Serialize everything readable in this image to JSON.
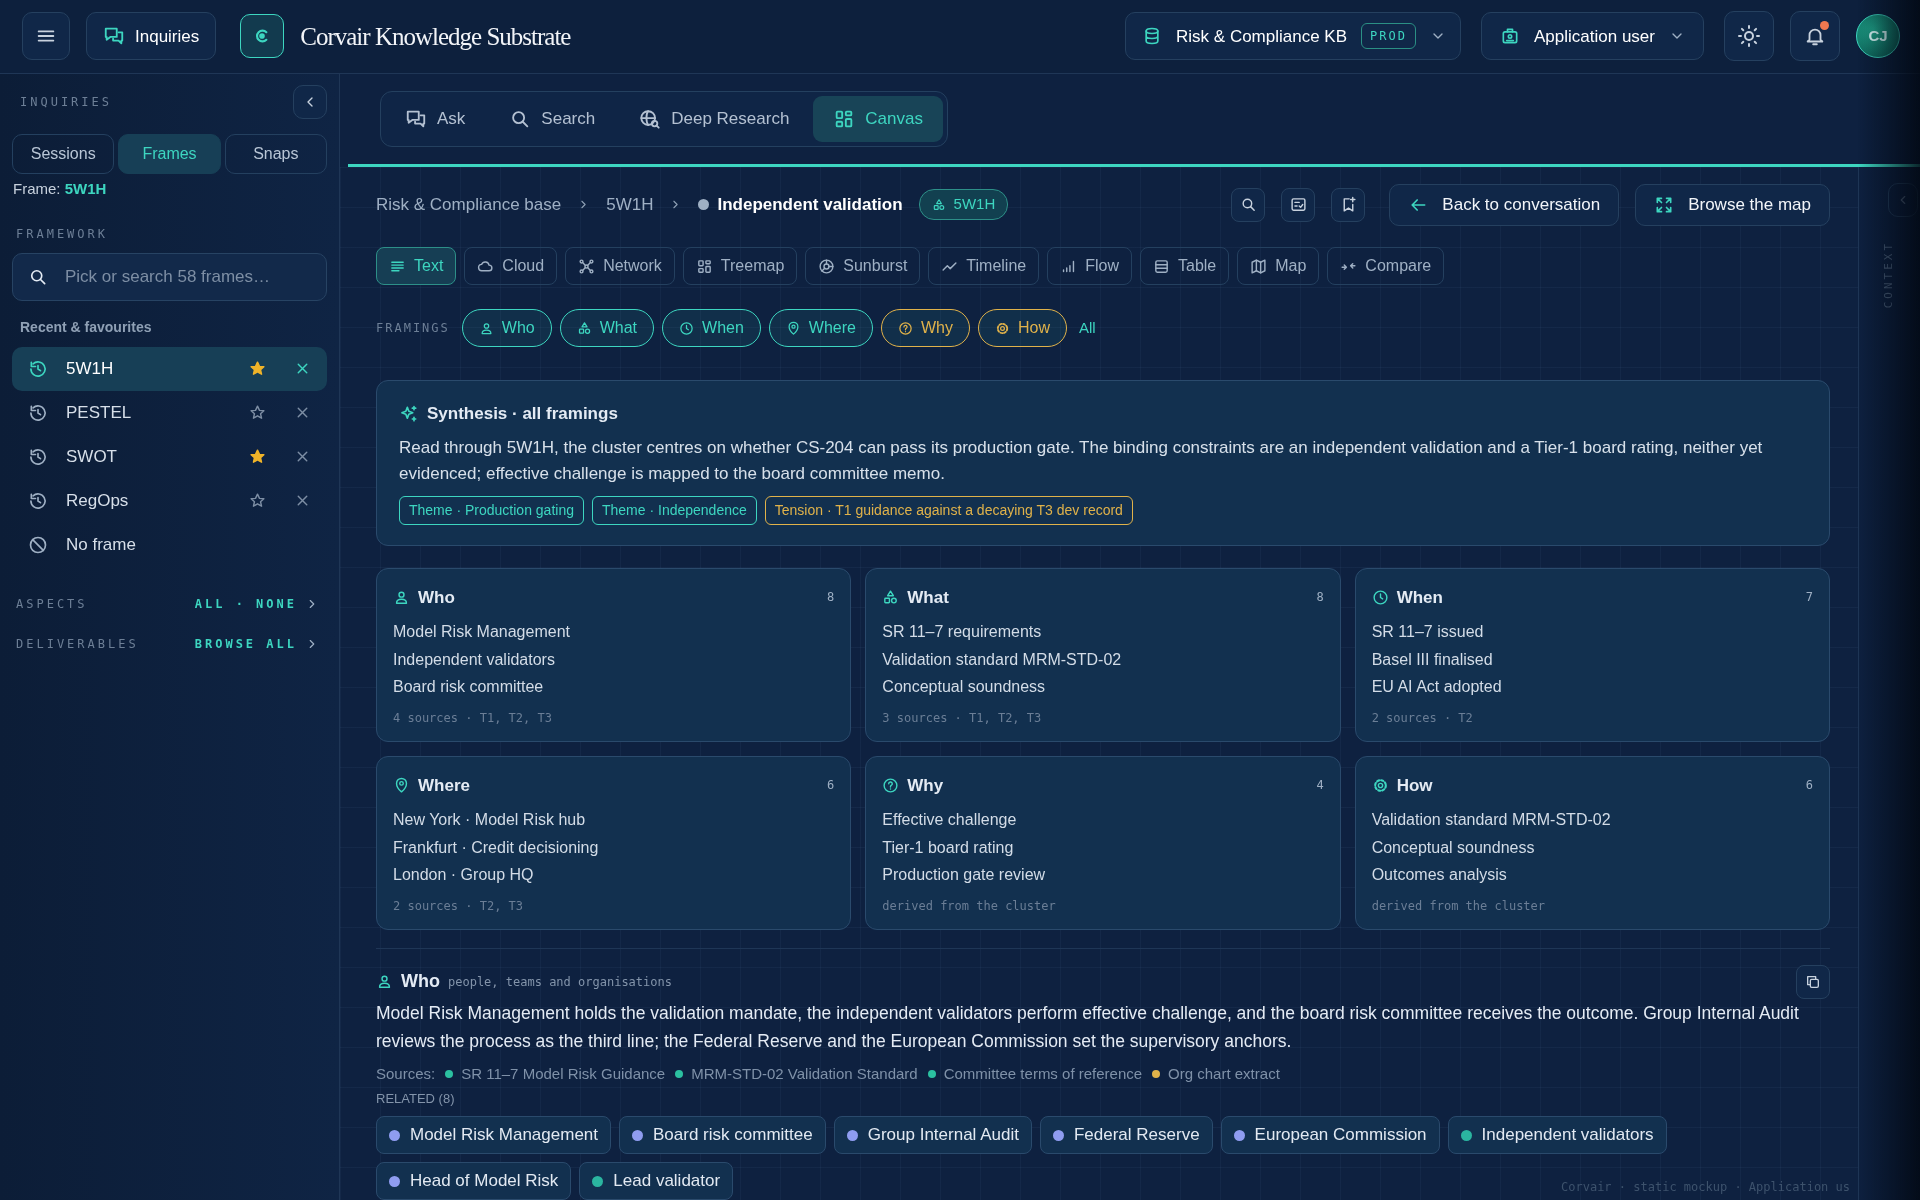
{
  "topbar": {
    "inquiries_button": "Inquiries",
    "title": "Corvair Knowledge Substrate",
    "kb_selector": {
      "label": "Risk & Compliance KB",
      "badge": "PROD"
    },
    "user_selector": "Application user",
    "notification_unread": true,
    "avatar": "CJ"
  },
  "sidebar": {
    "heading": "INQUIRIES",
    "tabs": [
      {
        "label": "Sessions",
        "selected": false
      },
      {
        "label": "Frames",
        "selected": true
      },
      {
        "label": "Snaps",
        "selected": false
      }
    ],
    "frame_label": "Frame:",
    "frame_value": "5W1H",
    "framework_heading": "FRAMEWORK",
    "search": {
      "placeholder": "Pick or search 58 frames…"
    },
    "recent_heading": "Recent & favourites",
    "frames": [
      {
        "kind": "history",
        "label": "5W1H",
        "starred": true,
        "selected": true
      },
      {
        "kind": "history",
        "label": "PESTEL",
        "starred": false,
        "selected": false
      },
      {
        "kind": "history",
        "label": "SWOT",
        "starred": true,
        "selected": false
      },
      {
        "kind": "history",
        "label": "RegOps",
        "starred": false,
        "selected": false
      },
      {
        "kind": "none",
        "label": "No frame",
        "selected": false
      }
    ],
    "sections": [
      {
        "label": "ASPECTS",
        "action": "ALL · NONE"
      },
      {
        "label": "DELIVERABLES",
        "action": "BROWSE ALL"
      }
    ]
  },
  "mode_tabs": [
    {
      "label": "Ask",
      "selected": false
    },
    {
      "label": "Search",
      "selected": false
    },
    {
      "label": "Deep Research",
      "selected": false
    },
    {
      "label": "Canvas",
      "selected": true
    }
  ],
  "breadcrumb": {
    "items": [
      "Risk & Compliance base",
      "5W1H"
    ],
    "current": "Independent validation",
    "badge": "5W1H"
  },
  "actions": [
    "Back to conversation",
    "Browse the map"
  ],
  "view_tabs": [
    {
      "label": "Text",
      "selected": true
    },
    {
      "label": "Cloud",
      "selected": false
    },
    {
      "label": "Network",
      "selected": false
    },
    {
      "label": "Treemap",
      "selected": false
    },
    {
      "label": "Sunburst",
      "selected": false
    },
    {
      "label": "Timeline",
      "selected": false
    },
    {
      "label": "Flow",
      "selected": false
    },
    {
      "label": "Table",
      "selected": false
    },
    {
      "label": "Map",
      "selected": false
    },
    {
      "label": "Compare",
      "selected": false
    }
  ],
  "framings": {
    "label": "FRAMINGS",
    "chips": [
      {
        "label": "Who",
        "color": "#3dd6c0"
      },
      {
        "label": "What",
        "color": "#3dd6c0"
      },
      {
        "label": "When",
        "color": "#3dd6c0"
      },
      {
        "label": "Where",
        "color": "#3dd6c0"
      },
      {
        "label": "Why",
        "color": "#e0b24a"
      },
      {
        "label": "How",
        "color": "#e0b24a"
      }
    ],
    "all_link": "All"
  },
  "synthesis": {
    "title": "Synthesis · all framings",
    "text": "Read through 5W1H, the cluster centres on whether CS-204 can pass its production gate. The binding constraints are an independent validation and a Tier-1 board rating, neither yet evidenced; effective challenge is mapped to the board committee memo.",
    "tags": [
      {
        "label": "Theme · Production gating",
        "color": "#3dd6c0"
      },
      {
        "label": "Theme · Independence",
        "color": "#3dd6c0"
      },
      {
        "label": "Tension · T1 guidance against a decaying T3 dev record",
        "color": "#e0b24a"
      }
    ]
  },
  "aspect_cards": [
    {
      "title": "Who",
      "count": "8",
      "items": [
        "Model Risk Management",
        "Independent validators",
        "Board risk committee"
      ],
      "footer": "4 sources · T1, T2, T3"
    },
    {
      "title": "What",
      "count": "8",
      "items": [
        "SR 11–7 requirements",
        "Validation standard MRM-STD-02",
        "Conceptual soundness"
      ],
      "footer": "3 sources · T1, T2, T3"
    },
    {
      "title": "When",
      "count": "7",
      "items": [
        "SR 11–7 issued",
        "Basel III finalised",
        "EU AI Act adopted"
      ],
      "footer": "2 sources · T2"
    },
    {
      "title": "Where",
      "count": "6",
      "items": [
        "New York · Model Risk hub",
        "Frankfurt · Credit decisioning",
        "London · Group HQ"
      ],
      "footer": "2 sources · T2, T3"
    },
    {
      "title": "Why",
      "count": "4",
      "items": [
        "Effective challenge",
        "Tier-1 board rating",
        "Production gate review"
      ],
      "footer": "derived from the cluster"
    },
    {
      "title": "How",
      "count": "6",
      "items": [
        "Validation standard MRM-STD-02",
        "Conceptual soundness",
        "Outcomes analysis"
      ],
      "footer": "derived from the cluster"
    }
  ],
  "detail": {
    "title": "Who",
    "subtitle": "people, teams and organisations",
    "text": "Model Risk Management holds the validation mandate, the independent validators perform effective challenge, and the board risk committee receives the outcome. Group Internal Audit reviews the process as the third line; the Federal Reserve and the European Commission set the supervisory anchors.",
    "sources_label": "Sources:",
    "sources": [
      {
        "label": "SR 11–7 Model Risk Guidance",
        "color": "#2bc0a0"
      },
      {
        "label": "MRM-STD-02 Validation Standard",
        "color": "#2bc0a0"
      },
      {
        "label": "Committee terms of reference",
        "color": "#2bc0a0"
      },
      {
        "label": "Org chart extract",
        "color": "#e0b24a"
      }
    ],
    "related_label": "RELATED (8)",
    "related": [
      {
        "label": "Model Risk Management",
        "color": "#8f9cf0"
      },
      {
        "label": "Board risk committee",
        "color": "#8f9cf0"
      },
      {
        "label": "Group Internal Audit",
        "color": "#8f9cf0"
      },
      {
        "label": "Federal Reserve",
        "color": "#8f9cf0"
      },
      {
        "label": "European Commission",
        "color": "#8f9cf0"
      },
      {
        "label": "Independent validators",
        "color": "#2bb5a0"
      },
      {
        "label": "Head of Model Risk",
        "color": "#8f9cf0"
      },
      {
        "label": "Lead validator",
        "color": "#2bb5a0"
      }
    ]
  },
  "footer_note": "Corvair · static mockup · Application us",
  "context_rail": "CONTEXT"
}
